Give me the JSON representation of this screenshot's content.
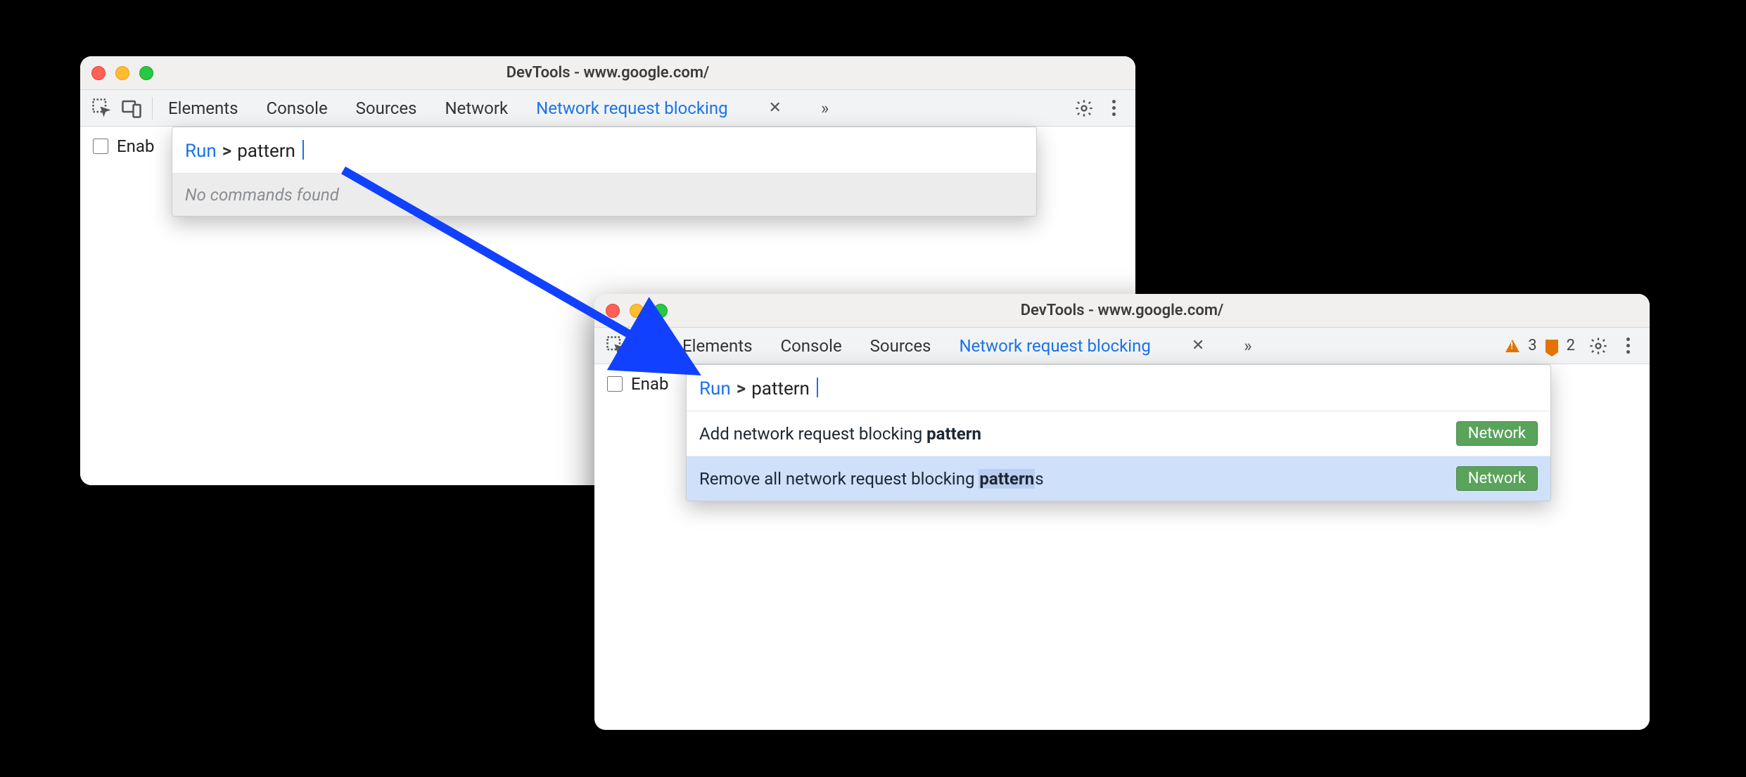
{
  "window1": {
    "title": "DevTools - www.google.com/",
    "tabs": {
      "elements": "Elements",
      "console": "Console",
      "sources": "Sources",
      "network": "Network",
      "blocking": "Network request blocking"
    },
    "enable_label": "Enab",
    "cmd": {
      "run": "Run",
      "prefix": ">",
      "query": "pattern",
      "empty": "No commands found"
    }
  },
  "window2": {
    "title": "DevTools - www.google.com/",
    "tabs": {
      "elements": "Elements",
      "console": "Console",
      "sources": "Sources",
      "blocking": "Network request blocking"
    },
    "counts": {
      "warn": "3",
      "flag": "2"
    },
    "enable_label": "Enab",
    "cmd": {
      "run": "Run",
      "prefix": ">",
      "query": "pattern",
      "items": [
        {
          "pre": "Add network request blocking ",
          "match": "pattern",
          "post": "",
          "pill": "Network"
        },
        {
          "pre": "Remove all network request blocking ",
          "match": "pattern",
          "post": "s",
          "pill": "Network"
        }
      ]
    }
  }
}
